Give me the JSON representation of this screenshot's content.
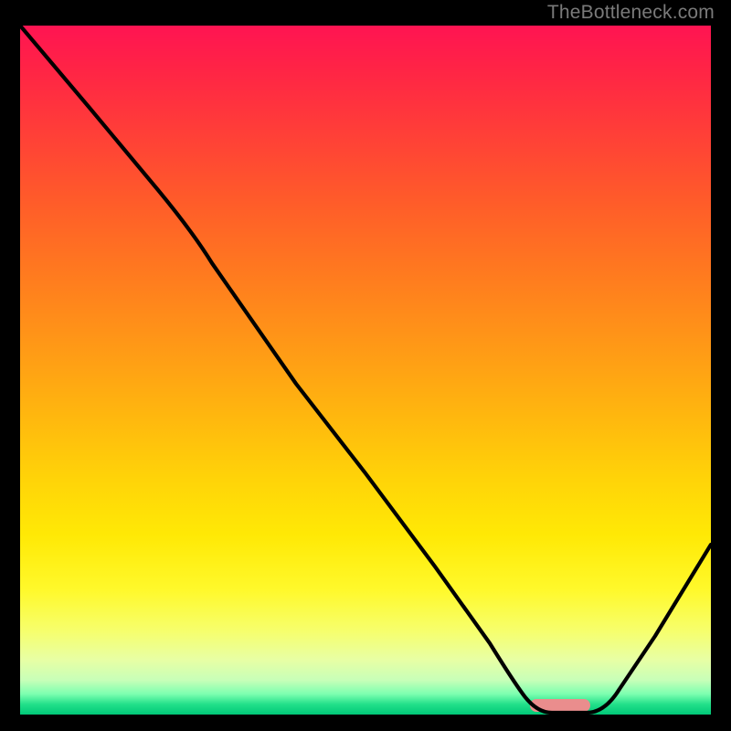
{
  "watermark": "TheBottleneck.com",
  "chart_data": {
    "type": "line",
    "title": "",
    "xlabel": "",
    "ylabel": "",
    "ylim": [
      0,
      100
    ],
    "xlim": [
      0,
      100
    ],
    "series": [
      {
        "name": "bottleneck-curve",
        "x": [
          0,
          10,
          20,
          25,
          30,
          40,
          50,
          60,
          68,
          73,
          77,
          82,
          88,
          94,
          100
        ],
        "y": [
          100,
          88,
          76,
          70,
          62,
          48,
          35,
          21,
          10,
          3,
          0,
          0,
          8,
          18,
          30
        ]
      }
    ],
    "optimum_marker": {
      "x_start": 74,
      "x_end": 82,
      "y": 1.4
    },
    "colors": {
      "curve": "#000000",
      "marker": "#ea8d8d",
      "gradient_top": "#ff1452",
      "gradient_bottom": "#00c878"
    }
  }
}
